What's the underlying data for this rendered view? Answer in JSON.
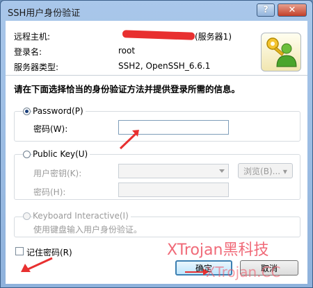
{
  "window": {
    "title": "SSH用户身份验证",
    "help_glyph": "?",
    "close_glyph": "✕"
  },
  "info": {
    "host_label": "远程主机:",
    "host_value_suffix": "(服务器1)",
    "user_label": "登录名:",
    "user_value": "root",
    "server_type_label": "服务器类型:",
    "server_type_value": "SSH2, OpenSSH_6.6.1"
  },
  "heading": "请在下面选择恰当的身份验证方法并提供登录所需的信息。",
  "password_group": {
    "option_label": "Password(P)",
    "field_label": "密码(W):",
    "field_value": ""
  },
  "publickey_group": {
    "option_label": "Public Key(U)",
    "user_key_label": "用户密钥(K):",
    "passphrase_label": "密码(H):",
    "browse_label": "浏览(B)... ▾"
  },
  "keyboard_group": {
    "option_label": "Keyboard Interactive(I)",
    "description": "使用键盘输入用户身份验证。"
  },
  "remember_label": "记住密码(R)",
  "buttons": {
    "ok": "确定",
    "cancel": "取消"
  },
  "watermark": {
    "line1": "XTrojan黑科技",
    "line2": "XTrojan.CC"
  },
  "colors": {
    "accent_red": "#e83030",
    "title_bg": "#a9c7ea",
    "close_red": "#c2402a"
  }
}
